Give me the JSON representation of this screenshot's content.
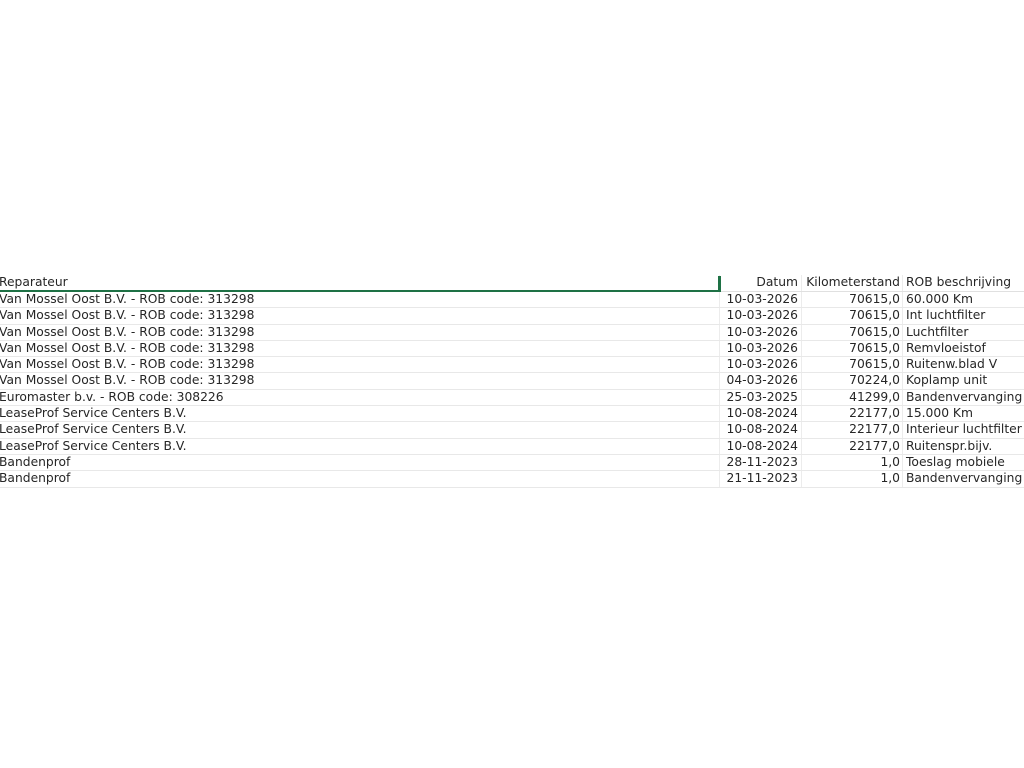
{
  "table": {
    "headers": {
      "reparateur": "Reparateur",
      "datum": "Datum",
      "kilometerstand": "Kilometerstand",
      "rob": "ROB beschrijving"
    },
    "rows": [
      {
        "reparateur": "Van Mossel Oost B.V. - ROB code: 313298",
        "datum": "10-03-2026",
        "kilometerstand": "70615,0",
        "rob": "60.000 Km"
      },
      {
        "reparateur": "Van Mossel Oost B.V. - ROB code: 313298",
        "datum": "10-03-2026",
        "kilometerstand": "70615,0",
        "rob": "Int luchtfilter"
      },
      {
        "reparateur": "Van Mossel Oost B.V. - ROB code: 313298",
        "datum": "10-03-2026",
        "kilometerstand": "70615,0",
        "rob": "Luchtfilter"
      },
      {
        "reparateur": "Van Mossel Oost B.V. - ROB code: 313298",
        "datum": "10-03-2026",
        "kilometerstand": "70615,0",
        "rob": "Remvloeistof"
      },
      {
        "reparateur": "Van Mossel Oost B.V. - ROB code: 313298",
        "datum": "10-03-2026",
        "kilometerstand": "70615,0",
        "rob": "Ruitenw.blad V"
      },
      {
        "reparateur": "Van Mossel Oost B.V. - ROB code: 313298",
        "datum": "04-03-2026",
        "kilometerstand": "70224,0",
        "rob": "Koplamp unit"
      },
      {
        "reparateur": "Euromaster b.v. - ROB code: 308226",
        "datum": "25-03-2025",
        "kilometerstand": "41299,0",
        "rob": "Bandenvervanging"
      },
      {
        "reparateur": "LeaseProf Service Centers B.V.",
        "datum": "10-08-2024",
        "kilometerstand": "22177,0",
        "rob": "15.000 Km"
      },
      {
        "reparateur": "LeaseProf Service Centers B.V.",
        "datum": "10-08-2024",
        "kilometerstand": "22177,0",
        "rob": "Interieur luchtfilter"
      },
      {
        "reparateur": "LeaseProf Service Centers B.V.",
        "datum": "10-08-2024",
        "kilometerstand": "22177,0",
        "rob": "Ruitenspr.bijv."
      },
      {
        "reparateur": "Bandenprof",
        "datum": "28-11-2023",
        "kilometerstand": "1,0",
        "rob": "Toeslag mobiele"
      },
      {
        "reparateur": "Bandenprof",
        "datum": "21-11-2023",
        "kilometerstand": "1,0",
        "rob": "Bandenvervanging"
      }
    ]
  },
  "colors": {
    "selection": "#1e7145",
    "gridline": "#e8e8e8",
    "text": "#262626"
  }
}
